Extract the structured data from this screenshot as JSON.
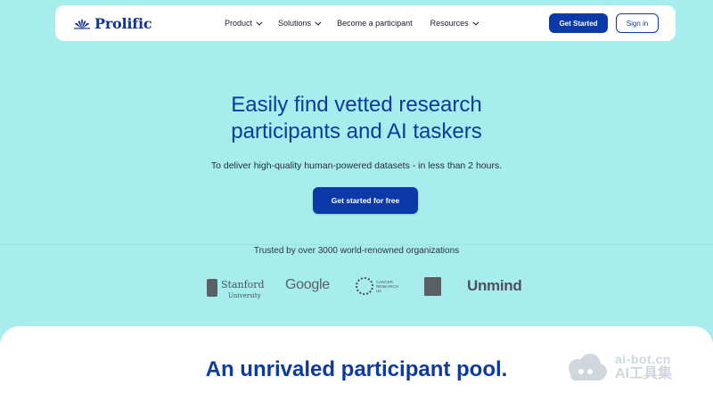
{
  "nav": {
    "logo_text": "Prolific",
    "items": [
      {
        "label": "Product",
        "has_dropdown": true
      },
      {
        "label": "Solutions",
        "has_dropdown": true
      },
      {
        "label": "Become a participant",
        "has_dropdown": false
      },
      {
        "label": "Resources",
        "has_dropdown": true
      }
    ],
    "get_started_label": "Get Started",
    "sign_in_label": "Sign in"
  },
  "hero": {
    "title_line1": "Easily find vetted research",
    "title_line2": "participants and AI taskers",
    "subtitle": "To deliver high-quality human-powered datasets - in less than 2 hours.",
    "cta_label": "Get started for free"
  },
  "trusted": {
    "text": "Trusted by over 3000 world-renowned organizations",
    "logos": [
      {
        "name": "Stanford",
        "sub": "University"
      },
      {
        "name": "Google"
      },
      {
        "name": "CANCER RESEARCH UK"
      },
      {
        "name": "Oxford crest",
        "icon": "oxford-crest-icon"
      },
      {
        "name": "Unmind"
      }
    ]
  },
  "section": {
    "title": "An unrivaled participant pool."
  },
  "watermark": {
    "line1": "ai-bot.cn",
    "line2": "AI工具集"
  },
  "colors": {
    "background": "#a8eded",
    "primary": "#0b3aa8",
    "heading": "#0e3a9e"
  }
}
